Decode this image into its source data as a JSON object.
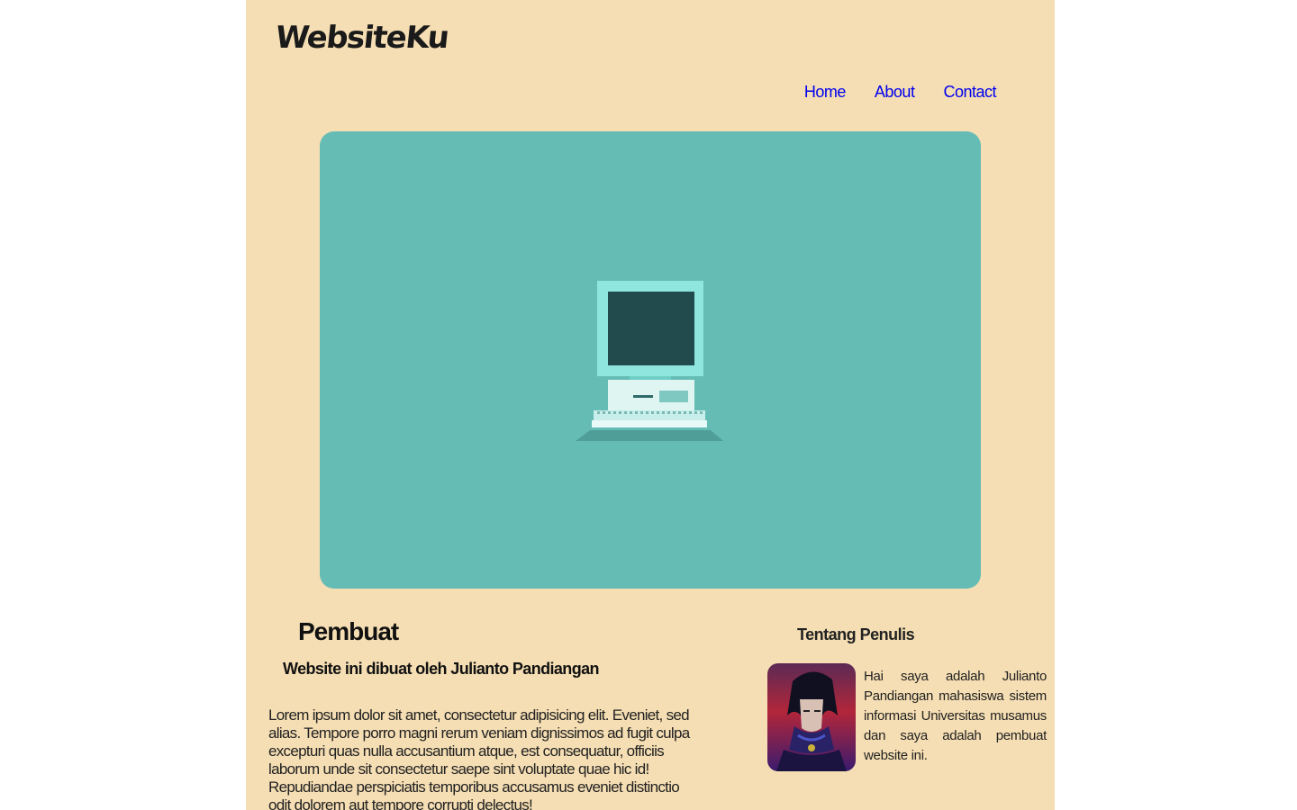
{
  "header": {
    "brand": "WebsiteKu",
    "nav": [
      {
        "label": "Home"
      },
      {
        "label": "About"
      },
      {
        "label": "Contact"
      }
    ]
  },
  "hero": {
    "illustration": "retro-computer-icon",
    "background_color": "#65bcb5"
  },
  "main": {
    "heading": "Pembuat",
    "subheading": "Website ini dibuat oleh Julianto Pandiangan",
    "body": "Lorem ipsum dolor sit amet, consectetur adipisicing elit. Eveniet, sed alias. Tempore porro magni rerum veniam dignissimos ad fugit culpa excepturi quas nulla accusantium atque, est consequatur, officiis laborum unde sit consectetur saepe sint voluptate quae hic id! Repudiandae perspiciatis temporibus accusamus eveniet distinctio odit dolorem aut tempore corrupti delectus!"
  },
  "aside": {
    "title": "Tentang Penulis",
    "avatar": "author-avatar",
    "text": "Hai saya adalah Julianto Pandiangan mahasiswa sistem informasi Universitas musamus dan saya adalah pembuat website ini."
  },
  "colors": {
    "page_background": "#f5deb3",
    "link": "#0000ee",
    "hero": "#65bcb5"
  }
}
